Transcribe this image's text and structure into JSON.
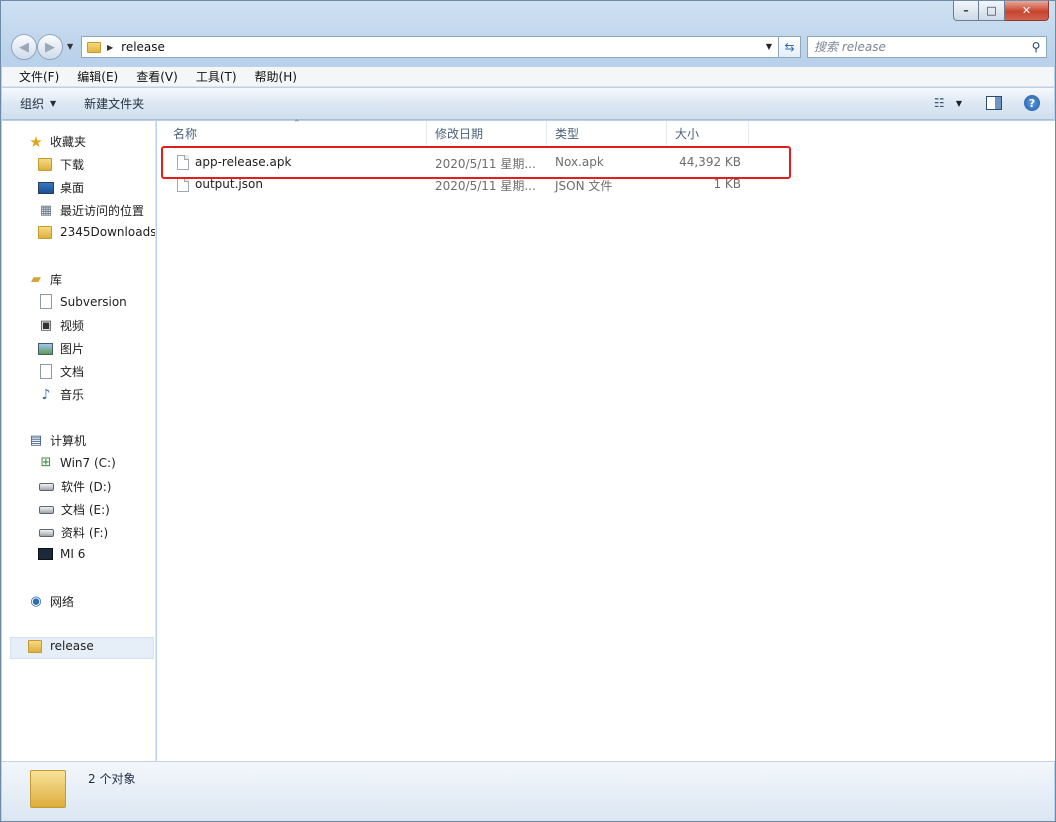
{
  "address": {
    "crumb": "release"
  },
  "search": {
    "placeholder": "搜索 release"
  },
  "menubar": [
    "文件(F)",
    "编辑(E)",
    "查看(V)",
    "工具(T)",
    "帮助(H)"
  ],
  "toolbar": {
    "organize": "组织",
    "new_folder": "新建文件夹"
  },
  "nav": {
    "favorites": "收藏夹",
    "favorites_items": [
      "下载",
      "桌面",
      "最近访问的位置",
      "2345Downloads"
    ],
    "libraries": "库",
    "library_items": [
      "Subversion",
      "视频",
      "图片",
      "文档",
      "音乐"
    ],
    "computer": "计算机",
    "computer_items": [
      "Win7 (C:)",
      "软件 (D:)",
      "文档 (E:)",
      "资料 (F:)",
      "MI 6"
    ],
    "network": "网络",
    "current": "release"
  },
  "columns": {
    "name": "名称",
    "date": "修改日期",
    "type": "类型",
    "size": "大小"
  },
  "files": [
    {
      "name": "app-release.apk",
      "date": "2020/5/11 星期...",
      "type": "Nox.apk",
      "size": "44,392 KB"
    },
    {
      "name": "output.json",
      "date": "2020/5/11 星期...",
      "type": "JSON 文件",
      "size": "1 KB"
    }
  ],
  "status": {
    "count": "2 个对象"
  },
  "colors": {
    "highlight": "#e31c1c",
    "titlebar": "#b9d1ea"
  }
}
